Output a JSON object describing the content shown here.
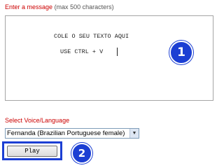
{
  "message": {
    "label": "Enter a message",
    "limit_note": "(max 500 characters)",
    "lines": [
      "COLE O SEU TEXTO AQUI",
      "USE CTRL + V"
    ]
  },
  "voice": {
    "label": "Select Voice/Language",
    "selected": "Fernanda (Brazilian Portuguese female)",
    "dropdown_icon": "chevron-down-icon"
  },
  "play": {
    "label": "Play"
  },
  "badges": [
    "1",
    "2"
  ],
  "colors": {
    "label_red": "#cc0000",
    "annotation_blue": "#1c3fd3"
  }
}
